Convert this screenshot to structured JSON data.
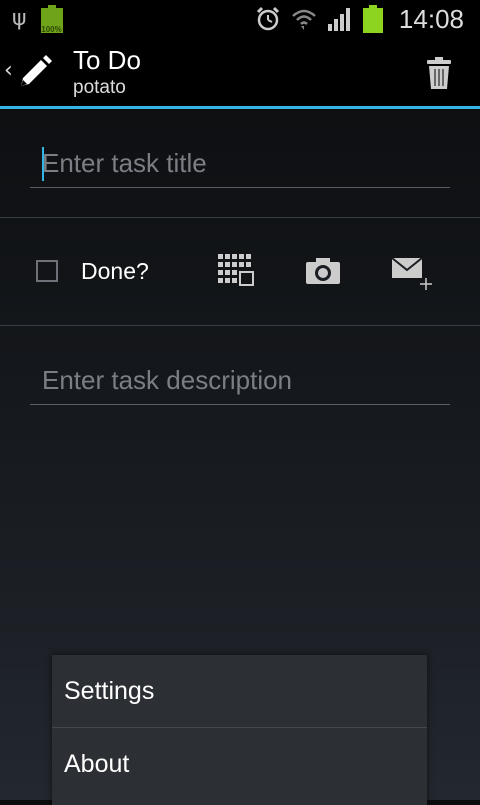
{
  "status_bar": {
    "battery_small_label": "100%",
    "time": "14:08"
  },
  "action_bar": {
    "title": "To Do",
    "subtitle": "potato",
    "back_glyph": "‹"
  },
  "task_title": {
    "placeholder": "Enter task title",
    "value": ""
  },
  "done": {
    "label": "Done?",
    "checked": false
  },
  "task_description": {
    "placeholder": "Enter task description",
    "value": ""
  },
  "menu": {
    "items": [
      {
        "label": "Settings"
      },
      {
        "label": "About"
      }
    ]
  },
  "colors": {
    "accent": "#33b5e5",
    "battery": "#6fa31a"
  },
  "icons": [
    "usb-icon",
    "battery-icon",
    "alarm-icon",
    "wifi-icon",
    "signal-icon",
    "pencil-icon",
    "trash-icon",
    "calendar-icon",
    "camera-icon",
    "email-add-icon"
  ]
}
